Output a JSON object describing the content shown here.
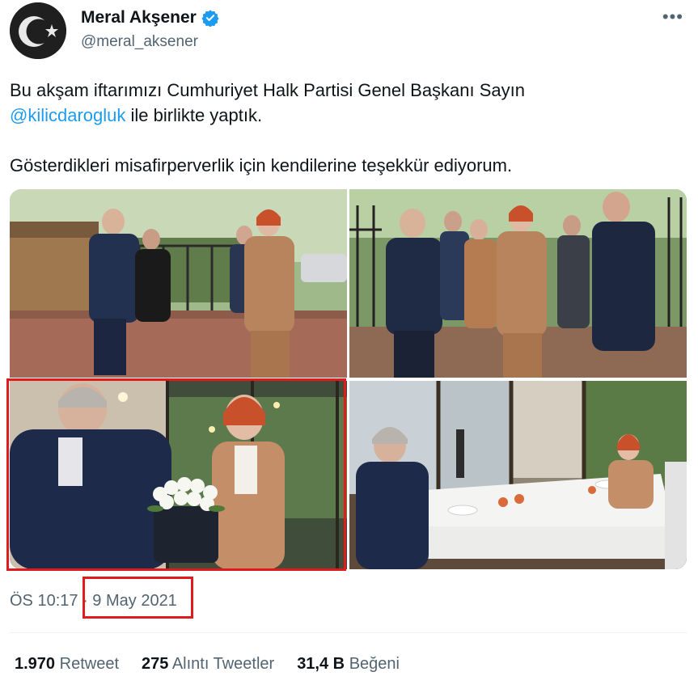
{
  "author": {
    "name": "Meral Akşener",
    "handle": "@meral_aksener",
    "verified_icon": "verified-badge-icon",
    "avatar_icon": "crescent-star-icon"
  },
  "more_label": "•••",
  "tweet": {
    "line1": "Bu akşam iftarımızı Cumhuriyet Halk Partisi Genel Başkanı Sayın",
    "mention": "@kilicdarogluk",
    "line2_rest": " ile birlikte yaptık.",
    "line3": "Gösterdikleri misafirperverlik için kendilerine teşekkür ediyorum."
  },
  "meta": {
    "time": "ÖS 10:17",
    "separator": " · ",
    "date": "9 May 2021"
  },
  "stats": {
    "retweets_count": "1.970",
    "retweets_label": "Retweet",
    "quotes_count": "275",
    "quotes_label": "Alıntı Tweetler",
    "likes_count": "31,4 B",
    "likes_label": "Beğeni"
  },
  "colors": {
    "accent": "#1d9bf0",
    "highlight": "#e01b1b",
    "secondary_text": "#536471"
  }
}
